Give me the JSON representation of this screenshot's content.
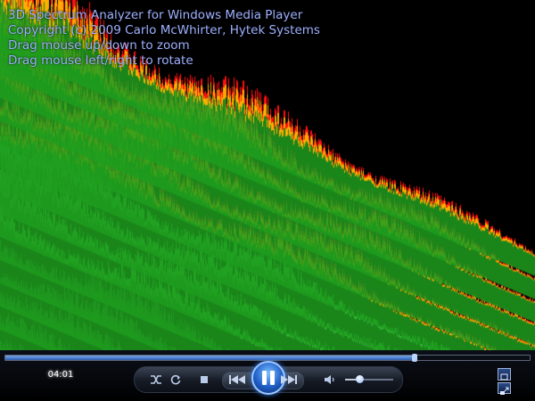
{
  "overlay": {
    "title": "3D Spectrum Analyzer for Windows Media Player",
    "copyright": "Copyright (c) 2009 Carlo McWhirter, Hytek Systems",
    "hint_zoom": "Drag mouse up/down to zoom",
    "hint_rotate": "Drag mouse left/right to rotate"
  },
  "player": {
    "elapsed_time": "04:01",
    "seek_progress": 0.78,
    "volume_level": 0.3,
    "state": "playing"
  },
  "controls": {
    "shuffle_icon": "shuffle-icon",
    "repeat_icon": "repeat-icon",
    "stop_icon": "stop-icon",
    "previous_icon": "previous-icon",
    "play_pause_icon": "pause-icon",
    "next_icon": "next-icon",
    "mute_icon": "speaker-icon",
    "fullscreen_icon": "fullscreen-icon",
    "compact_icon": "switch-to-compact-icon"
  },
  "colors": {
    "overlay_text": "#9db0ff",
    "spectrum_high": "#ff1010",
    "spectrum_mid": "#ffae00",
    "spectrum_low": "#1f9e1f",
    "play_button": "#2a7ae8"
  }
}
